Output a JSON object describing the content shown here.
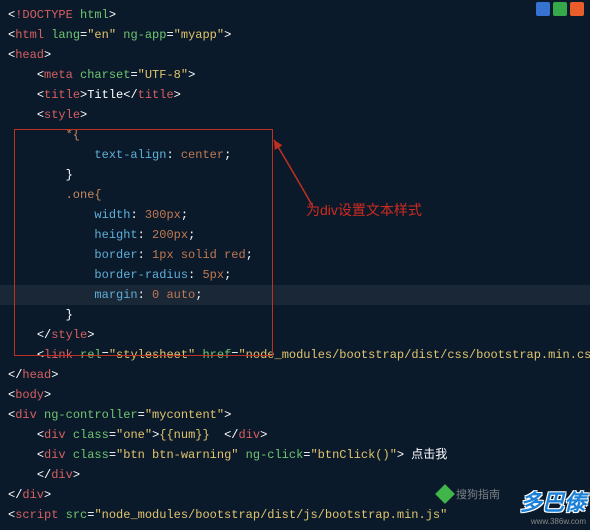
{
  "annotation": "为div设置文本样式",
  "watermark1": "搜狗指南",
  "watermark2": "多巴傣",
  "watermark2_url": "www.386w.com",
  "code": {
    "l1": {
      "tag": "!DOCTYPE",
      "attr": "html"
    },
    "l2": {
      "tag": "html",
      "a1": "lang",
      "v1": "\"en\"",
      "a2": "ng-app",
      "v2": "\"myapp\""
    },
    "l3": {
      "tag": "head"
    },
    "l4": {
      "tag": "meta",
      "a1": "charset",
      "v1": "\"UTF-8\""
    },
    "l5": {
      "open": "title",
      "text": "Title",
      "close": "title"
    },
    "l6": {
      "tag": "style"
    },
    "l7": {
      "sel": "*{"
    },
    "l8": {
      "prop": "text-align",
      "val": " center",
      "semi": ";"
    },
    "l9": {
      "close": "}"
    },
    "l10": {
      "sel": ".one{"
    },
    "l11": {
      "prop": "width",
      "val": " 300px",
      "semi": ";"
    },
    "l12": {
      "prop": "height",
      "val": " 200px",
      "semi": ";"
    },
    "l13": {
      "prop": "border",
      "val": " 1px solid red",
      "semi": ";"
    },
    "l14": {
      "prop": "border-radius",
      "val": " 5px",
      "semi": ";"
    },
    "l15": {
      "prop": "margin",
      "val": " 0 auto",
      "semi": ";"
    },
    "l16": {
      "close": "}"
    },
    "l17": {
      "tag": "style"
    },
    "l18": {
      "tag": "link",
      "a1": "rel",
      "v1": "\"stylesheet\"",
      "a2": "href",
      "v2": "\"node_modules/bootstrap/dist/css/bootstrap.min.css\""
    },
    "l19": {
      "tag": "head"
    },
    "l20": {
      "tag": "body"
    },
    "l21": {
      "tag": "div",
      "a1": "ng-controller",
      "v1": "\"mycontent\""
    },
    "l22": {
      "tag": "div",
      "a1": "class",
      "v1": "\"one\"",
      "expr": "{{num}}",
      "ctag": "div"
    },
    "l23": {
      "tag": "div",
      "a1": "class",
      "v1": "\"btn btn-warning\"",
      "a2": "ng-click",
      "v2": "\"btnClick()\"",
      "text": " 点击我"
    },
    "l24": {
      "tag": "div"
    },
    "l25": {
      "tag": "div"
    },
    "l26": {
      "tag": "script",
      "a1": "src",
      "v1": "\"node_modules/bootstrap/dist/js/bootstrap.min.js\""
    }
  }
}
